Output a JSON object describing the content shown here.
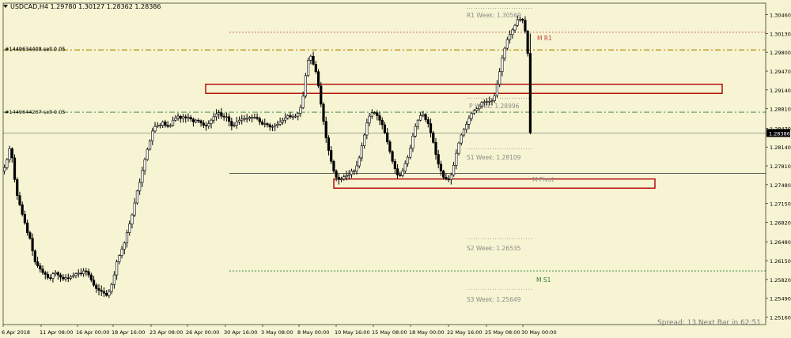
{
  "header": {
    "title": "USDCAD,H4  1.29780 1.30127 1.28362 1.28386"
  },
  "colors": {
    "background": "#f6f4d2",
    "candle": "#000000",
    "grid_text": "#000000",
    "box": "#b00000",
    "pivot_label": "#8c8c8c",
    "monthly_r1": "#c04040",
    "monthly_s1": "#2e7d32",
    "order_line": "#2e7d32",
    "order_line_gold": "#b8860b",
    "price_marker_bg": "#000000",
    "price_marker_text": "#ffffff"
  },
  "annotations": {
    "r1_week": "R1 Week: 1.30569",
    "m_r1": "M R1",
    "p_week": "P Week: 1.28996",
    "s1_week": "S1 Week: 1.28109",
    "m_pivot": "M Pivot",
    "s2_week": "S2 Week: 1.26535",
    "m_s1": "M S1",
    "s3_week": "S3 Week: 1.25649",
    "order_1": "#1449634408 sell 0.05",
    "order_1_overlap": "#1449644267 sell 0.05",
    "order_2": "#1449644267 sell 0.05",
    "spread": "Spread: 13  Next Bar in 62:51",
    "current_price": "1.28386"
  },
  "chart_data": {
    "type": "candlestick",
    "symbol": "USDCAD",
    "timeframe": "H4",
    "ohlc_header": {
      "open": 1.2978,
      "high": 1.30127,
      "low": 1.28362,
      "close": 1.28386
    },
    "y_ticks": [
      "1.30460",
      "1.30130",
      "1.29800",
      "1.29470",
      "1.29140",
      "1.28810",
      "1.28470",
      "1.28140",
      "1.27810",
      "1.27480",
      "1.27150",
      "1.26820",
      "1.26480",
      "1.26150",
      "1.25820",
      "1.25490",
      "1.25160"
    ],
    "x_ticks": [
      "6 Apr 2018",
      "11 Apr 08:00",
      "16 Apr 00:00",
      "18 Apr 16:00",
      "23 Apr 08:00",
      "26 Apr 00:00",
      "30 Apr 16:00",
      "3 May 08:00",
      "8 May 00:00",
      "10 May 16:00",
      "15 May 08:00",
      "18 May 00:00",
      "22 May 16:00",
      "25 May 08:00",
      "30 May 00:00"
    ],
    "ylim": [
      1.2503,
      1.3066
    ],
    "levels": {
      "r1_week": 1.30569,
      "m_r1": 1.3015,
      "order_1": 1.2984,
      "p_week": 1.28996,
      "order_2": 1.2875,
      "s1_week": 1.28109,
      "m_pivot": 1.2768,
      "s2_week": 1.26535,
      "m_s1": 1.2597,
      "s3_week": 1.25649,
      "current": 1.28386
    },
    "zones": [
      {
        "from": 1.2908,
        "to": 1.2924
      },
      {
        "from": 1.2742,
        "to": 1.2758
      }
    ],
    "closes": [
      1.2778,
      1.2792,
      1.2811,
      1.2795,
      1.2757,
      1.2729,
      1.2713,
      1.2696,
      1.2681,
      1.2664,
      1.2654,
      1.2632,
      1.2613,
      1.2606,
      1.26,
      1.2594,
      1.2591,
      1.2585,
      1.2584,
      1.2592,
      1.2594,
      1.259,
      1.2586,
      1.2583,
      1.2585,
      1.2584,
      1.2587,
      1.2589,
      1.2592,
      1.2593,
      1.2592,
      1.2597,
      1.2596,
      1.259,
      1.2581,
      1.2572,
      1.2566,
      1.2563,
      1.2561,
      1.2558,
      1.2554,
      1.2561,
      1.2573,
      1.259,
      1.2613,
      1.2624,
      1.2635,
      1.2646,
      1.2664,
      1.2679,
      1.2695,
      1.2716,
      1.2737,
      1.2752,
      1.2773,
      1.2792,
      1.281,
      1.2825,
      1.2842,
      1.285,
      1.2852,
      1.2852,
      1.2858,
      1.2852,
      1.285,
      1.2852,
      1.2861,
      1.2865,
      1.2868,
      1.2864,
      1.2867,
      1.2865,
      1.2866,
      1.2863,
      1.2858,
      1.2861,
      1.286,
      1.2856,
      1.2852,
      1.2851,
      1.2855,
      1.2861,
      1.2867,
      1.2872,
      1.2874,
      1.2868,
      1.2867,
      1.2867,
      1.2859,
      1.2851,
      1.2852,
      1.2858,
      1.2861,
      1.2863,
      1.2864,
      1.2864,
      1.2866,
      1.2866,
      1.2866,
      1.2864,
      1.2858,
      1.2854,
      1.2855,
      1.2853,
      1.2849,
      1.285,
      1.2852,
      1.2854,
      1.2858,
      1.2861,
      1.2865,
      1.2869,
      1.2867,
      1.2867,
      1.2868,
      1.2873,
      1.2883,
      1.2903,
      1.2939,
      1.2966,
      1.2973,
      1.2959,
      1.2946,
      1.2921,
      1.2889,
      1.2859,
      1.283,
      1.2808,
      1.2789,
      1.2772,
      1.2761,
      1.2757,
      1.2758,
      1.2762,
      1.2764,
      1.2766,
      1.2772,
      1.2772,
      1.2781,
      1.2795,
      1.2816,
      1.2835,
      1.2856,
      1.2868,
      1.2874,
      1.2874,
      1.2869,
      1.2861,
      1.2853,
      1.2839,
      1.2823,
      1.2806,
      1.2789,
      1.2776,
      1.2765,
      1.2764,
      1.2772,
      1.2785,
      1.2796,
      1.2812,
      1.2833,
      1.285,
      1.2861,
      1.2869,
      1.2871,
      1.2862,
      1.2855,
      1.2839,
      1.2822,
      1.2801,
      1.2784,
      1.2772,
      1.2761,
      1.2758,
      1.2757,
      1.2765,
      1.2782,
      1.2803,
      1.2821,
      1.2835,
      1.2845,
      1.2854,
      1.2864,
      1.2873,
      1.2878,
      1.2881,
      1.2886,
      1.2892,
      1.2893,
      1.2894,
      1.2894,
      1.2895,
      1.2904,
      1.2924,
      1.2946,
      1.297,
      1.2987,
      1.3002,
      1.3011,
      1.3019,
      1.3027,
      1.3037,
      1.3038,
      1.3036,
      1.3017,
      1.2978,
      1.2839
    ]
  }
}
